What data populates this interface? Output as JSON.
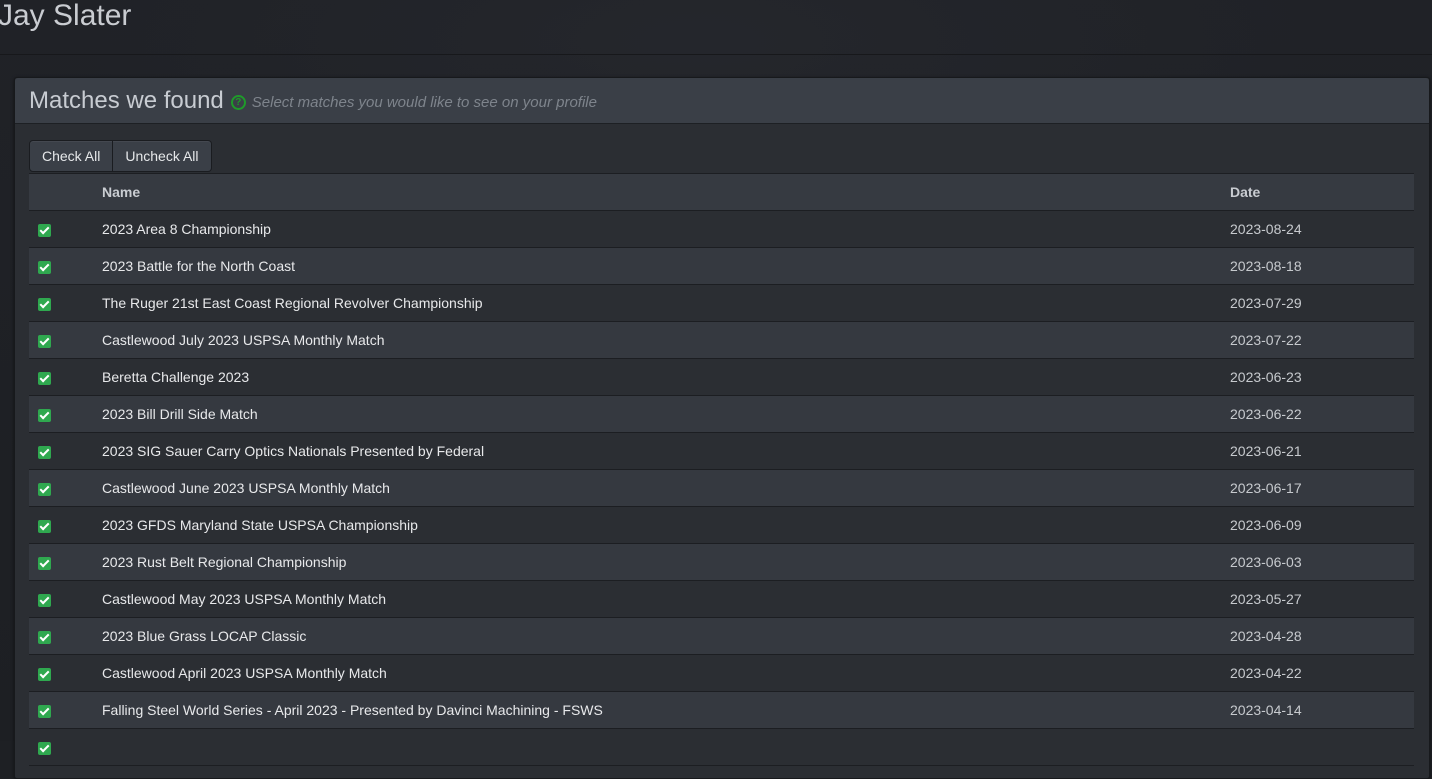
{
  "page": {
    "title": "Jay Slater"
  },
  "panel": {
    "title": "Matches we found",
    "help_icon": "question-circle-icon",
    "hint": "Select matches you would like to see on your profile",
    "accent_color": "#1f9a2a"
  },
  "toolbar": {
    "check_all_label": "Check All",
    "uncheck_all_label": "Uncheck All"
  },
  "table": {
    "columns": {
      "check": "",
      "name": "Name",
      "date": "Date"
    },
    "checkbox_color": "#2fa84f",
    "rows": [
      {
        "checked": true,
        "name": "2023 Area 8 Championship",
        "date": "2023-08-24"
      },
      {
        "checked": true,
        "name": "2023 Battle for the North Coast",
        "date": "2023-08-18"
      },
      {
        "checked": true,
        "name": "The Ruger 21st East Coast Regional Revolver Championship",
        "date": "2023-07-29"
      },
      {
        "checked": true,
        "name": "Castlewood July 2023 USPSA Monthly Match",
        "date": "2023-07-22"
      },
      {
        "checked": true,
        "name": "Beretta Challenge 2023",
        "date": "2023-06-23"
      },
      {
        "checked": true,
        "name": "2023 Bill Drill Side Match",
        "date": "2023-06-22"
      },
      {
        "checked": true,
        "name": "2023 SIG Sauer Carry Optics Nationals Presented by Federal",
        "date": "2023-06-21"
      },
      {
        "checked": true,
        "name": "Castlewood June 2023 USPSA Monthly Match",
        "date": "2023-06-17"
      },
      {
        "checked": true,
        "name": "2023 GFDS Maryland State USPSA Championship",
        "date": "2023-06-09"
      },
      {
        "checked": true,
        "name": "2023 Rust Belt Regional Championship",
        "date": "2023-06-03"
      },
      {
        "checked": true,
        "name": "Castlewood May 2023 USPSA Monthly Match",
        "date": "2023-05-27"
      },
      {
        "checked": true,
        "name": "2023 Blue Grass LOCAP Classic",
        "date": "2023-04-28"
      },
      {
        "checked": true,
        "name": "Castlewood April 2023 USPSA Monthly Match",
        "date": "2023-04-22"
      },
      {
        "checked": true,
        "name": "Falling Steel World Series - April 2023 - Presented by Davinci Machining - FSWS",
        "date": "2023-04-14"
      },
      {
        "checked": true,
        "name": "",
        "date": ""
      }
    ]
  }
}
